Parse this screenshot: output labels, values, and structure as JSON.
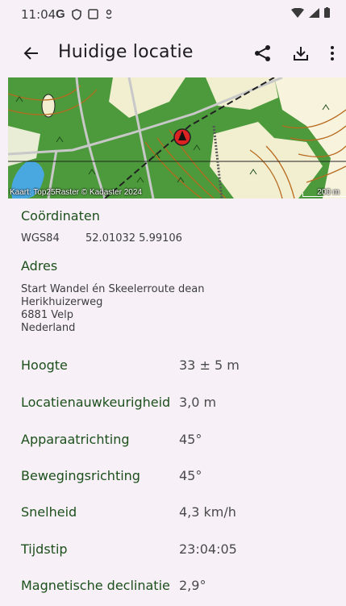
{
  "status": {
    "time": "11:04"
  },
  "appbar": {
    "title": "Huidige locatie"
  },
  "map": {
    "attribution": "Kaart: Top25Raster © Kadaster 2024",
    "scale_label": "200 m"
  },
  "coordinates": {
    "title": "Coördinaten",
    "system": "WGS84",
    "value": "52.01032  5.99106"
  },
  "address": {
    "title": "Adres",
    "lines": [
      "Start Wandel én Skeelerroute dean",
      "Herikhuizerweg",
      "6881 Velp",
      "Nederland"
    ]
  },
  "properties": [
    {
      "label": "Hoogte",
      "value": "33 ± 5 m"
    },
    {
      "label": "Locatienauwkeurigheid",
      "value": "3,0 m"
    },
    {
      "label": "Apparaatrichting",
      "value": "45°"
    },
    {
      "label": "Bewegingsrichting",
      "value": "45°"
    },
    {
      "label": "Snelheid",
      "value": "4,3 km/h"
    },
    {
      "label": "Tijdstip",
      "value": "23:04:05"
    },
    {
      "label": "Magnetische declinatie",
      "value": "2,9°"
    }
  ],
  "colors": {
    "accent": "#1c4f1c",
    "background": "#f7f1f7"
  }
}
